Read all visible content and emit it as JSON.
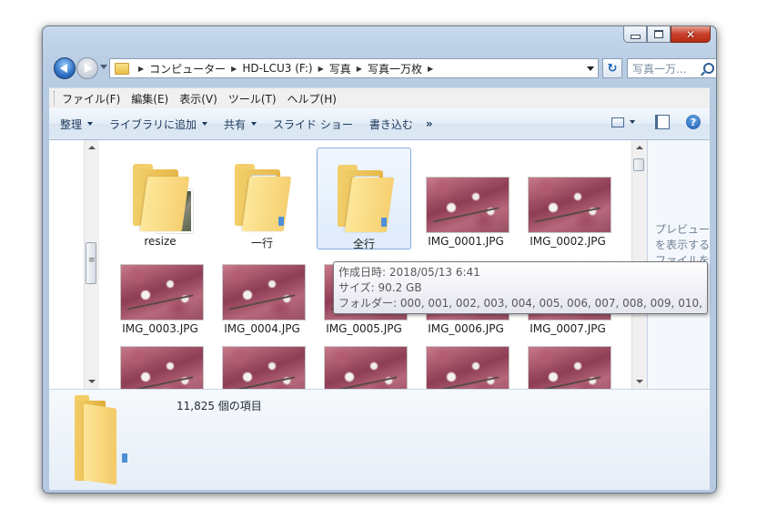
{
  "window": {
    "buttons": {
      "minimize": "minimize",
      "maximize": "maximize",
      "close": "✕"
    }
  },
  "nav": {
    "breadcrumbs": [
      "コンピューター",
      "HD-LCU3 (F:)",
      "写真",
      "写真一万枚"
    ],
    "search_placeholder": "写真一万...",
    "refresh_glyph": "↻"
  },
  "menu": [
    "ファイル(F)",
    "編集(E)",
    "表示(V)",
    "ツール(T)",
    "ヘルプ(H)"
  ],
  "commands": {
    "organize": "整理",
    "add_to_library": "ライブラリに追加",
    "share": "共有",
    "slideshow": "スライド ショー",
    "burn": "書き込む",
    "more": "»"
  },
  "items": [
    {
      "name": "resize",
      "kind": "folder-photo"
    },
    {
      "name": "一行",
      "kind": "folder-doc"
    },
    {
      "name": "全行",
      "kind": "folder-doc",
      "selected": true
    },
    {
      "name": "IMG_0001.JPG",
      "kind": "photo"
    },
    {
      "name": "IMG_0002.JPG",
      "kind": "photo"
    },
    {
      "name": "IMG_0003.JPG",
      "kind": "photo"
    },
    {
      "name": "IMG_0004.JPG",
      "kind": "photo"
    },
    {
      "name": "IMG_0005.JPG",
      "kind": "photo"
    },
    {
      "name": "IMG_0006.JPG",
      "kind": "photo"
    },
    {
      "name": "IMG_0007.JPG",
      "kind": "photo"
    },
    {
      "name": "",
      "kind": "photo"
    },
    {
      "name": "",
      "kind": "photo"
    },
    {
      "name": "",
      "kind": "photo"
    },
    {
      "name": "",
      "kind": "photo"
    },
    {
      "name": "",
      "kind": "photo"
    }
  ],
  "tooltip": {
    "created": "作成日時: 2018/05/13 6:41",
    "size": "サイズ: 90.2 GB",
    "folders": "フォルダー: 000, 001, 002, 003, 004, 005, 006, 007, 008, 009, 010, ..."
  },
  "preview_text": "プレビューを表示するファイルを",
  "status": {
    "item_count": "11,825 個の項目"
  }
}
